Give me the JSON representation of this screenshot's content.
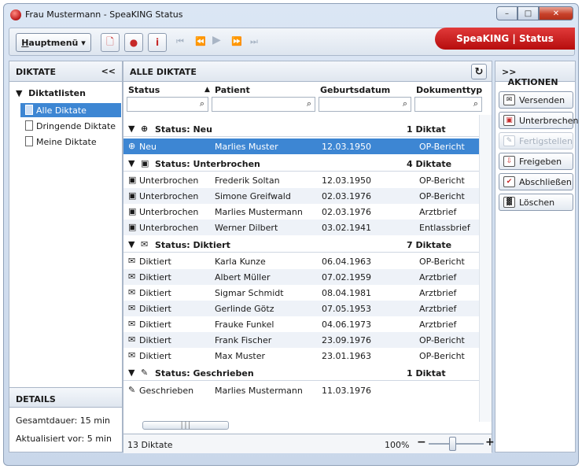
{
  "window": {
    "title": "Frau Mustermann - SpeaKING Status"
  },
  "toolbar": {
    "menu_label": "Hauptmenü",
    "menu_underline": "H",
    "menu_rest": "auptmenü",
    "brand": "SpeaKING | Status"
  },
  "sidebar": {
    "title": "DIKTATE",
    "collapse": "<<",
    "group": "Diktatlisten",
    "items": [
      "Alle Diktate",
      "Dringende Diktate",
      "Meine Diktate"
    ]
  },
  "details": {
    "title": "DETAILS",
    "total_label": "Gesamtdauer:",
    "total_value": "15 min",
    "updated_label": "Aktualisiert vor:",
    "updated_value": "5 min"
  },
  "main": {
    "title": "ALLE DIKTATE",
    "columns": [
      "Status",
      "Patient",
      "Geburtsdatum",
      "Dokumenttyp"
    ],
    "groups": [
      {
        "label": "Status: Neu",
        "count": "1 Diktat",
        "icon": "plus-circle-icon"
      },
      {
        "label": "Status: Unterbrochen",
        "count": "4 Diktate",
        "icon": "interrupted-icon"
      },
      {
        "label": "Status: Diktiert",
        "count": "7 Diktate",
        "icon": "envelope-icon"
      },
      {
        "label": "Status: Geschrieben",
        "count": "1 Diktat",
        "icon": "written-icon"
      }
    ],
    "rows": [
      [
        "Neu",
        "Marlies Muster",
        "12.03.1950",
        "OP-Bericht"
      ],
      [
        "Unterbrochen",
        "Frederik Soltan",
        "12.03.1950",
        "OP-Bericht"
      ],
      [
        "Unterbrochen",
        "Simone Greifwald",
        "02.03.1976",
        "OP-Bericht"
      ],
      [
        "Unterbrochen",
        "Marlies Mustermann",
        "02.03.1976",
        "Arztbrief"
      ],
      [
        "Unterbrochen",
        "Werner Dilbert",
        "03.02.1941",
        "Entlassbrief"
      ],
      [
        "Diktiert",
        "Karla Kunze",
        "06.04.1963",
        "OP-Bericht"
      ],
      [
        "Diktiert",
        "Albert Müller",
        "07.02.1959",
        "Arztbrief"
      ],
      [
        "Diktiert",
        "Sigmar Schmidt",
        "08.04.1981",
        "Arztbrief"
      ],
      [
        "Diktiert",
        "Gerlinde Götz",
        "07.05.1953",
        "Arztbrief"
      ],
      [
        "Diktiert",
        "Frauke Funkel",
        "04.06.1973",
        "Arztbrief"
      ],
      [
        "Diktiert",
        "Frank Fischer",
        "23.09.1976",
        "OP-Bericht"
      ],
      [
        "Diktiert",
        "Max Muster",
        "23.01.1963",
        "OP-Bericht"
      ],
      [
        "Geschrieben",
        "Marlies Mustermann",
        "11.03.1976",
        ""
      ]
    ],
    "status_count": "13 Diktate",
    "zoom": "100%"
  },
  "actions": {
    "title": "AKTIONEN",
    "expand": ">>",
    "buttons": [
      "Versenden",
      "Unterbrechen",
      "Fertigstellen",
      "Freigeben",
      "Abschließen",
      "Löschen"
    ],
    "disabled": [
      "Fertigstellen"
    ]
  },
  "colors": {
    "selection": "#3d86d3",
    "brand": "#c81e1e"
  }
}
